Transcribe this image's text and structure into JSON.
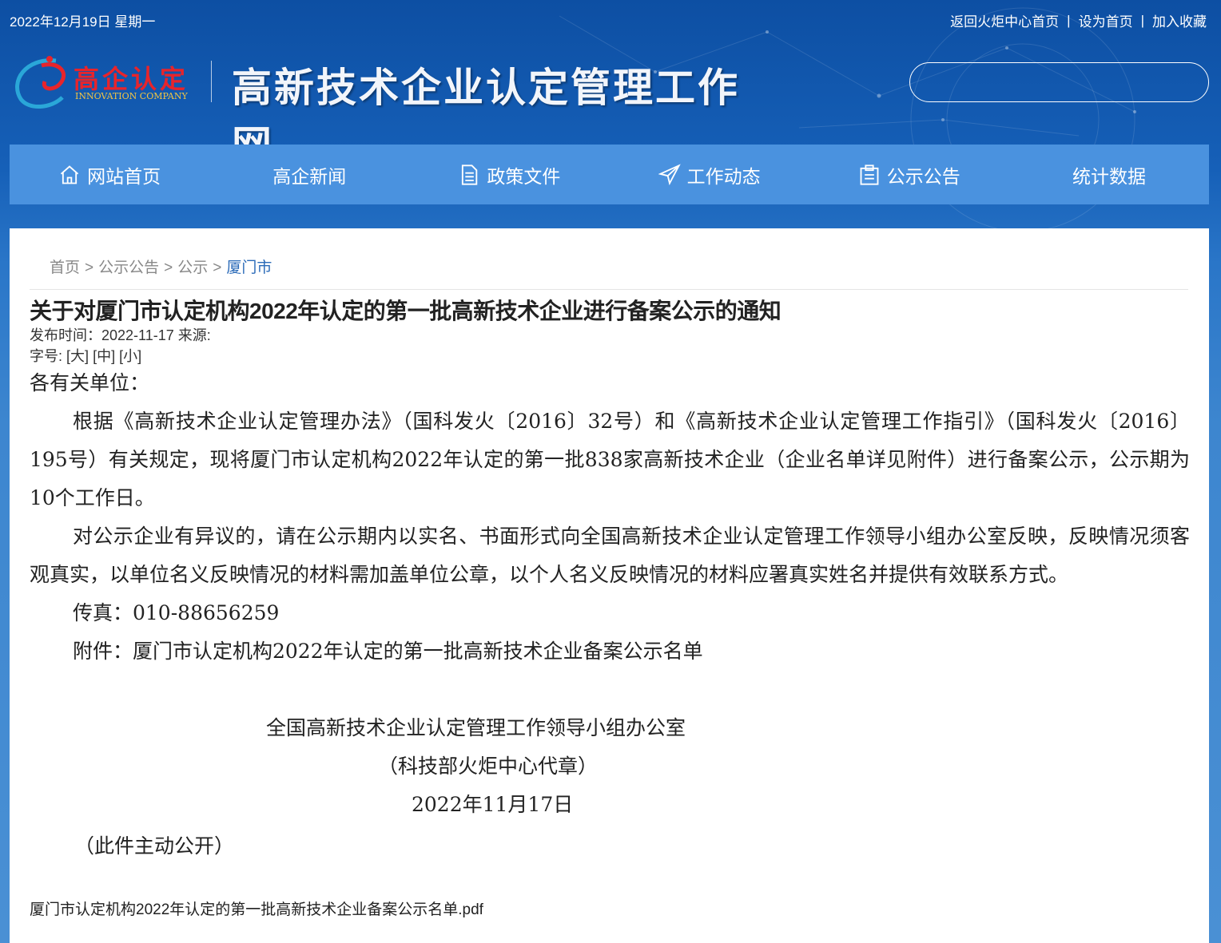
{
  "top": {
    "date": "2022年12月19日 星期一",
    "links": [
      "返回火炬中心首页",
      "设为首页",
      "加入收藏"
    ]
  },
  "header": {
    "logo_cn": "高企认定",
    "logo_en": "INNOVATION COMPANY",
    "site_title": "高新技术企业认定管理工作网",
    "search_placeholder": ""
  },
  "nav": [
    {
      "label": "网站首页",
      "icon": "home-icon"
    },
    {
      "label": "高企新闻",
      "icon": ""
    },
    {
      "label": "政策文件",
      "icon": "document-icon"
    },
    {
      "label": "工作动态",
      "icon": "paper-plane-icon"
    },
    {
      "label": "公示公告",
      "icon": "clipboard-icon"
    },
    {
      "label": "统计数据",
      "icon": ""
    }
  ],
  "breadcrumb": {
    "items": [
      "首页",
      "公示公告",
      "公示"
    ],
    "current": "厦门市",
    "separator": ">"
  },
  "article": {
    "title": "关于对厦门市认定机构2022年认定的第一批高新技术企业进行备案公示的通知",
    "publish_label": "发布时间：",
    "publish_date": "2022-11-17",
    "source_label": "来源:",
    "font_label": "字号:",
    "font_sizes": [
      "[大]",
      "[中]",
      "[小]"
    ],
    "salutation": "各有关单位：",
    "para1": "根据《高新技术企业认定管理办法》（国科发火〔2016〕32号）和《高新技术企业认定管理工作指引》（国科发火〔2016〕195号）有关规定，现将厦门市认定机构2022年认定的第一批838家高新技术企业（企业名单详见附件）进行备案公示，公示期为10个工作日。",
    "para2": "对公示企业有异议的，请在公示期内以实名、书面形式向全国高新技术企业认定管理工作领导小组办公室反映，反映情况须客观真实，以单位名义反映情况的材料需加盖单位公章，以个人名义反映情况的材料应署真实姓名并提供有效联系方式。",
    "fax": "传真：010-88656259",
    "attachment_line": "附件：厦门市认定机构2022年认定的第一批高新技术企业备案公示名单",
    "signature_org": "全国高新技术企业认定管理工作领导小组办公室",
    "signature_proxy": "（科技部火炬中心代章）",
    "signature_date": "2022年11月17日",
    "public_note": "（此件主动公开）",
    "attachment_file": "厦门市认定机构2022年认定的第一批高新技术企业备案公示名单.pdf"
  },
  "colors": {
    "nav_bg": "#4a92df",
    "header_bg": "#1660b8",
    "logo_red": "#e8242b",
    "breadcrumb_current": "#2a6ab8"
  }
}
